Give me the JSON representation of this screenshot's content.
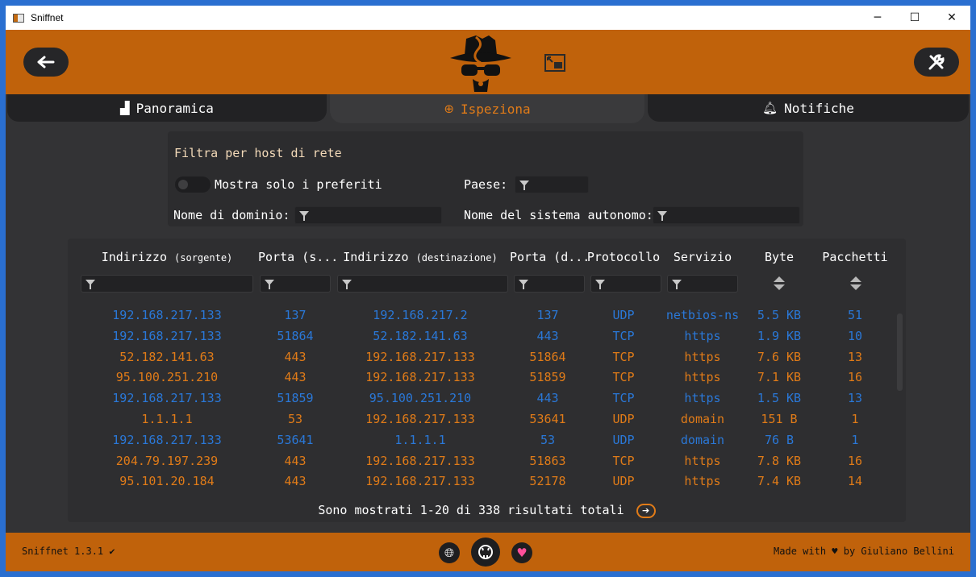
{
  "window": {
    "title": "Sniffnet",
    "minimize": "─",
    "maximize": "☐",
    "close": "✕"
  },
  "header": {
    "back_icon": "arrow-left-icon",
    "settings_icon": "wrench-icon"
  },
  "tabs": [
    {
      "label": "Panoramica",
      "icon": "chart-icon"
    },
    {
      "label": "Ispeziona",
      "icon": "search-icon",
      "active": true
    },
    {
      "label": "Notifiche",
      "icon": "bell-icon"
    }
  ],
  "filters": {
    "title": "Filtra per host di rete",
    "favorites_label": "Mostra solo i preferiti",
    "country_label": "Paese:",
    "domain_label": "Nome di dominio:",
    "as_label": "Nome del sistema autonomo:"
  },
  "table": {
    "headers": [
      {
        "main": "Indirizzo",
        "sub": "(sorgente)"
      },
      {
        "main": "Porta (s...",
        "sub": ""
      },
      {
        "main": "Indirizzo",
        "sub": "(destinazione)"
      },
      {
        "main": "Porta (d...",
        "sub": ""
      },
      {
        "main": "Protocollo",
        "sub": ""
      },
      {
        "main": "Servizio",
        "sub": ""
      },
      {
        "main": "Byte",
        "sub": ""
      },
      {
        "main": "Pacchetti",
        "sub": ""
      }
    ],
    "rows": [
      {
        "dir": "out",
        "cells": [
          "192.168.217.133",
          "137",
          "192.168.217.2",
          "137",
          "UDP",
          "netbios-ns",
          "5.5 KB",
          "51"
        ]
      },
      {
        "dir": "out",
        "cells": [
          "192.168.217.133",
          "51864",
          "52.182.141.63",
          "443",
          "TCP",
          "https",
          "1.9 KB",
          "10"
        ]
      },
      {
        "dir": "in",
        "cells": [
          "52.182.141.63",
          "443",
          "192.168.217.133",
          "51864",
          "TCP",
          "https",
          "7.6 KB",
          "13"
        ]
      },
      {
        "dir": "in",
        "cells": [
          "95.100.251.210",
          "443",
          "192.168.217.133",
          "51859",
          "TCP",
          "https",
          "7.1 KB",
          "16"
        ]
      },
      {
        "dir": "out",
        "cells": [
          "192.168.217.133",
          "51859",
          "95.100.251.210",
          "443",
          "TCP",
          "https",
          "1.5 KB",
          "13"
        ]
      },
      {
        "dir": "in",
        "cells": [
          "1.1.1.1",
          "53",
          "192.168.217.133",
          "53641",
          "UDP",
          "domain",
          "151 B",
          "1"
        ]
      },
      {
        "dir": "out",
        "cells": [
          "192.168.217.133",
          "53641",
          "1.1.1.1",
          "53",
          "UDP",
          "domain",
          "76 B",
          "1"
        ]
      },
      {
        "dir": "in",
        "cells": [
          "204.79.197.239",
          "443",
          "192.168.217.133",
          "51863",
          "TCP",
          "https",
          "7.8 KB",
          "16"
        ]
      },
      {
        "dir": "in",
        "cells": [
          "95.101.20.184",
          "443",
          "192.168.217.133",
          "52178",
          "UDP",
          "https",
          "7.4 KB",
          "14"
        ]
      }
    ],
    "pager_text": "Sono mostrati 1-20 di 338 risultati totali",
    "colors": {
      "out": "#2a78d8",
      "in": "#e07b18"
    }
  },
  "footer": {
    "version": "Sniffnet 1.3.1 ✔",
    "made_with": "Made with ♥ by Giuliano Bellini",
    "icons": [
      "globe-icon",
      "github-icon",
      "heart-icon"
    ]
  }
}
